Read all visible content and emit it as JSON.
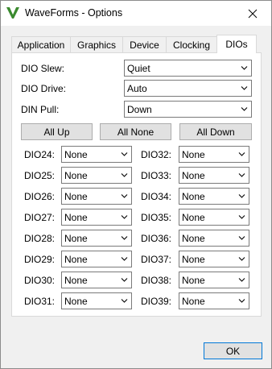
{
  "window": {
    "title": "WaveForms - Options"
  },
  "tabs": [
    {
      "label": "Application",
      "active": false
    },
    {
      "label": "Graphics",
      "active": false
    },
    {
      "label": "Device",
      "active": false
    },
    {
      "label": "Clocking",
      "active": false
    },
    {
      "label": "DIOs",
      "active": true
    }
  ],
  "settings": {
    "slew": {
      "label": "DIO Slew:",
      "value": "Quiet"
    },
    "drive": {
      "label": "DIO Drive:",
      "value": "Auto"
    },
    "pull": {
      "label": "DIN Pull:",
      "value": "Down"
    }
  },
  "buttons": {
    "all_up": "All Up",
    "all_none": "All None",
    "all_down": "All Down",
    "ok": "OK"
  },
  "dio_left": [
    {
      "label": "DIO24:",
      "value": "None"
    },
    {
      "label": "DIO25:",
      "value": "None"
    },
    {
      "label": "DIO26:",
      "value": "None"
    },
    {
      "label": "DIO27:",
      "value": "None"
    },
    {
      "label": "DIO28:",
      "value": "None"
    },
    {
      "label": "DIO29:",
      "value": "None"
    },
    {
      "label": "DIO30:",
      "value": "None"
    },
    {
      "label": "DIO31:",
      "value": "None"
    }
  ],
  "dio_right": [
    {
      "label": "DIO32:",
      "value": "None"
    },
    {
      "label": "DIO33:",
      "value": "None"
    },
    {
      "label": "DIO34:",
      "value": "None"
    },
    {
      "label": "DIO35:",
      "value": "None"
    },
    {
      "label": "DIO36:",
      "value": "None"
    },
    {
      "label": "DIO37:",
      "value": "None"
    },
    {
      "label": "DIO38:",
      "value": "None"
    },
    {
      "label": "DIO39:",
      "value": "None"
    }
  ],
  "colors": {
    "logo": "#3a8a2e",
    "accent": "#0078d7",
    "dialog_bg": "#f0f0f0",
    "panel_bg": "#ffffff"
  }
}
